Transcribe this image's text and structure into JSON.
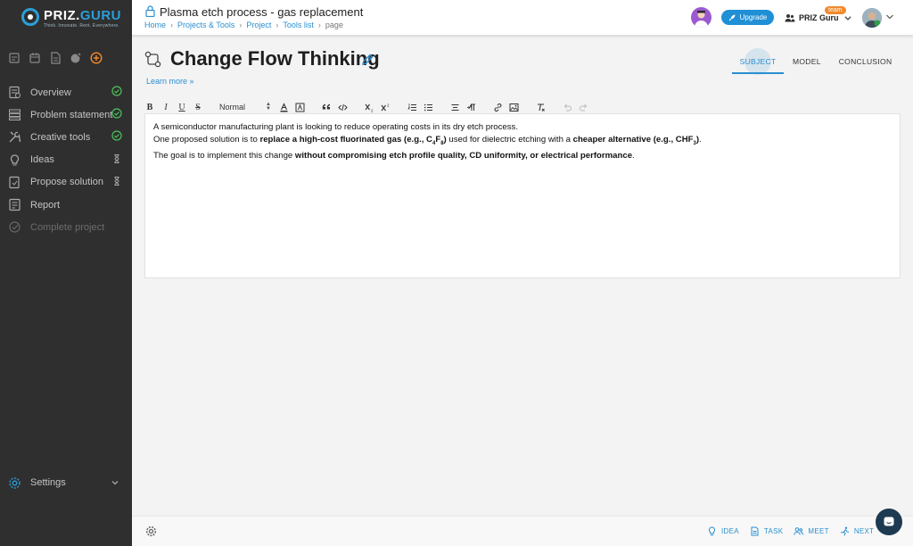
{
  "brand": {
    "logo_prefix": "PRIZ.",
    "logo_suffix": "GURU",
    "tagline": "Think. Innovate. Rent. Everywhere.",
    "accent_color": "#2a8fd0",
    "sidebar_color": "#2f2f2f",
    "success_color": "#4cc35c"
  },
  "sidebar": {
    "quick_icons": [
      "calendar-icon",
      "calendar-grid-icon",
      "document-icon",
      "globe-add-icon",
      "add-circle-icon"
    ],
    "items": [
      {
        "label": "Overview",
        "icon": "overview-icon",
        "status": "done"
      },
      {
        "label": "Problem statement",
        "icon": "list-icon",
        "status": "done"
      },
      {
        "label": "Creative tools",
        "icon": "tools-icon",
        "status": "done"
      },
      {
        "label": "Ideas",
        "icon": "lightbulb-icon",
        "status": "pending"
      },
      {
        "label": "Propose solution",
        "icon": "propose-icon",
        "status": "pending"
      },
      {
        "label": "Report",
        "icon": "report-icon",
        "status": "none"
      },
      {
        "label": "Complete project",
        "icon": "complete-icon",
        "status": "disabled"
      }
    ],
    "settings_label": "Settings"
  },
  "topbar": {
    "project_title": "Plasma etch process - gas replacement",
    "breadcrumb": [
      "Home",
      "Projects & Tools",
      "Project",
      "Tools list",
      "page"
    ],
    "upgrade_label": "Upgrade",
    "team_name": "PRIZ Guru",
    "team_badge": "team"
  },
  "main": {
    "page_title": "Change Flow Thinking",
    "learn_more": "Learn more »",
    "tabs": [
      {
        "label": "SUBJECT",
        "active": true
      },
      {
        "label": "MODEL",
        "active": false
      },
      {
        "label": "CONCLUSION",
        "active": false
      }
    ],
    "toolbar": {
      "bold": "B",
      "italic": "I",
      "underline": "U",
      "strike": "S",
      "size_label": "Normal"
    },
    "editor": {
      "line1": "A semiconductor manufacturing plant is looking to reduce operating costs in its dry etch process.",
      "line2_a": "One proposed solution is to ",
      "line2_b": "replace a high-cost fluorinated gas (e.g., C",
      "line2_b_sub1": "4",
      "line2_b_mid": "F",
      "line2_b_sub2": "8",
      "line2_b_end": ")",
      "line2_c": " used for dielectric etching with a ",
      "line2_d": "cheaper alternative (e.g., CHF",
      "line2_d_sub": "3",
      "line2_d_end": ")",
      "line2_e": ".",
      "line3_a": "The goal is to implement this change ",
      "line3_b": "without compromising etch profile quality, CD uniformity, or electrical performance",
      "line3_c": "."
    }
  },
  "footer": {
    "actions": [
      {
        "label": "IDEA",
        "icon": "lightbulb-icon"
      },
      {
        "label": "TASK",
        "icon": "task-icon"
      },
      {
        "label": "MEET",
        "icon": "meet-icon"
      },
      {
        "label": "NEXT",
        "icon": "next-icon"
      }
    ]
  }
}
